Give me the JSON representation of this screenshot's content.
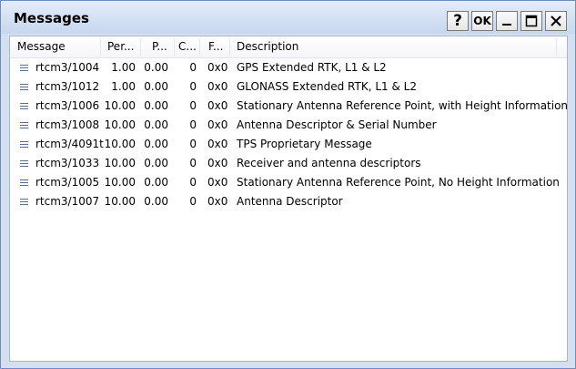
{
  "window": {
    "title": "Messages",
    "buttons": {
      "help": "?",
      "ok": "OK"
    }
  },
  "table": {
    "columns": [
      "Message",
      "Per...",
      "P...",
      "C...",
      "F...",
      "Description"
    ],
    "rows": [
      {
        "message": "rtcm3/1004",
        "period": "1.00",
        "phase": "0.00",
        "count": "0",
        "flags": "0x0",
        "description": "GPS Extended RTK, L1 & L2"
      },
      {
        "message": "rtcm3/1012",
        "period": "1.00",
        "phase": "0.00",
        "count": "0",
        "flags": "0x0",
        "description": "GLONASS Extended RTK, L1 & L2"
      },
      {
        "message": "rtcm3/1006",
        "period": "10.00",
        "phase": "0.00",
        "count": "0",
        "flags": "0x0",
        "description": "Stationary Antenna Reference Point, with Height Information"
      },
      {
        "message": "rtcm3/1008",
        "period": "10.00",
        "phase": "0.00",
        "count": "0",
        "flags": "0x0",
        "description": "Antenna Descriptor & Serial Number"
      },
      {
        "message": "rtcm3/4091t",
        "period": "10.00",
        "phase": "0.00",
        "count": "0",
        "flags": "0x0",
        "description": "TPS Proprietary Message"
      },
      {
        "message": "rtcm3/1033",
        "period": "10.00",
        "phase": "0.00",
        "count": "0",
        "flags": "0x0",
        "description": "Receiver and antenna descriptors"
      },
      {
        "message": "rtcm3/1005",
        "period": "10.00",
        "phase": "0.00",
        "count": "0",
        "flags": "0x0",
        "description": "Stationary Antenna Reference Point, No Height Information"
      },
      {
        "message": "rtcm3/1007",
        "period": "10.00",
        "phase": "0.00",
        "count": "0",
        "flags": "0x0",
        "description": "Antenna Descriptor"
      }
    ]
  }
}
